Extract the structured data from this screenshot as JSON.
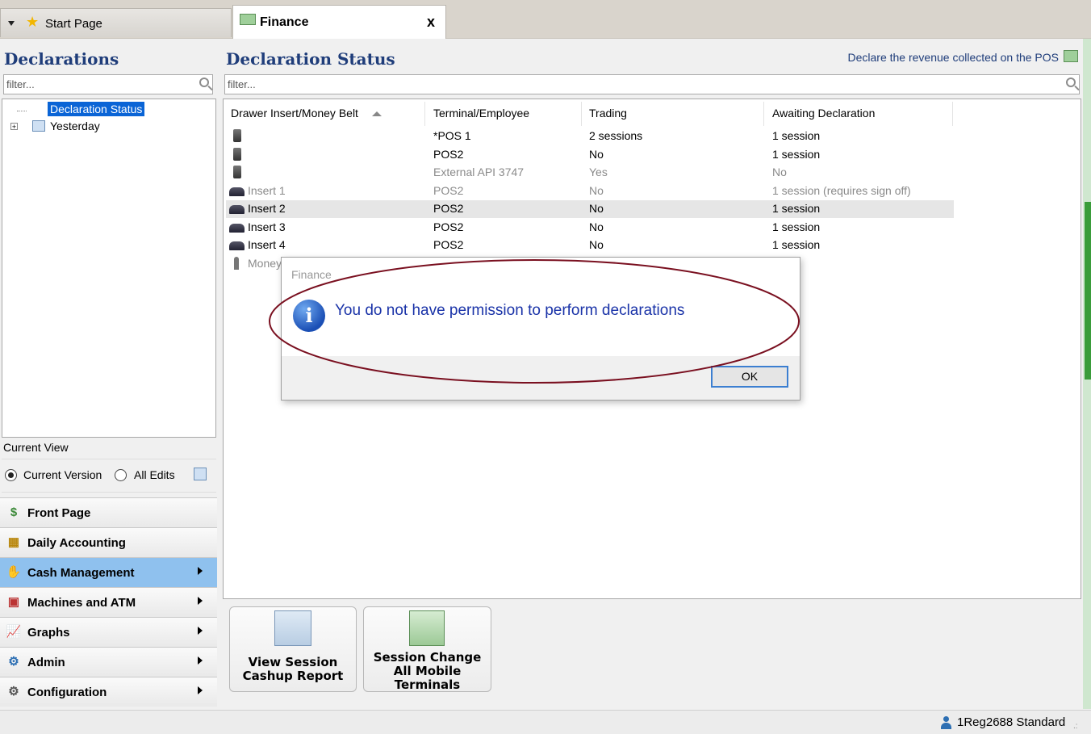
{
  "tabs": {
    "start_label": "Start Page",
    "finance_label": "Finance",
    "close_glyph": "x"
  },
  "sidebar": {
    "title": "Declarations",
    "filter_placeholder": "filter...",
    "tree": [
      {
        "label": "Declaration Status",
        "selected": true
      },
      {
        "label": "Yesterday",
        "selected": false
      }
    ],
    "current_view_label": "Current View",
    "radio_current": "Current Version",
    "radio_all": "All Edits",
    "nav": [
      {
        "label": "Front Page",
        "icon": "money-icon",
        "active": false,
        "arrow": false
      },
      {
        "label": "Daily Accounting",
        "icon": "calculator-icon",
        "active": false,
        "arrow": false
      },
      {
        "label": "Cash Management",
        "icon": "cash-hand-icon",
        "active": true,
        "arrow": true
      },
      {
        "label": "Machines and ATM",
        "icon": "machine-icon",
        "active": false,
        "arrow": true
      },
      {
        "label": "Graphs",
        "icon": "graph-icon",
        "active": false,
        "arrow": true
      },
      {
        "label": "Admin",
        "icon": "admin-icon",
        "active": false,
        "arrow": true
      },
      {
        "label": "Configuration",
        "icon": "gear-icon",
        "active": false,
        "arrow": true
      }
    ]
  },
  "main": {
    "title": "Declaration Status",
    "hint": "Declare the revenue collected on the POS",
    "filter_placeholder": "filter...",
    "columns": [
      "Drawer Insert/Money Belt",
      "Terminal/Employee",
      "Trading",
      "Awaiting Declaration"
    ],
    "rows": [
      {
        "drawer": "",
        "icon": "terminal",
        "terminal": "*POS 1",
        "trading": "2 sessions",
        "awaiting": "1 session",
        "grey": false,
        "highlight": false
      },
      {
        "drawer": "",
        "icon": "terminal",
        "terminal": "POS2",
        "trading": "No",
        "awaiting": "1 session",
        "grey": false,
        "highlight": false
      },
      {
        "drawer": "",
        "icon": "terminal",
        "terminal": "External API 3747",
        "trading": "Yes",
        "awaiting": "No",
        "grey": true,
        "highlight": false
      },
      {
        "drawer": "Insert 1",
        "icon": "insert",
        "terminal": "POS2",
        "trading": "No",
        "awaiting": "1 session (requires sign off)",
        "grey": true,
        "highlight": false
      },
      {
        "drawer": "Insert 2",
        "icon": "insert",
        "terminal": "POS2",
        "trading": "No",
        "awaiting": "1 session",
        "grey": false,
        "highlight": true
      },
      {
        "drawer": "Insert 3",
        "icon": "insert",
        "terminal": "POS2",
        "trading": "No",
        "awaiting": "1 session",
        "grey": false,
        "highlight": false
      },
      {
        "drawer": "Insert 4",
        "icon": "insert",
        "terminal": "POS2",
        "trading": "No",
        "awaiting": "1 session",
        "grey": false,
        "highlight": false
      },
      {
        "drawer": "Money",
        "icon": "person",
        "terminal": "",
        "trading": "",
        "awaiting": "",
        "grey": true,
        "highlight": false
      }
    ],
    "actions": [
      {
        "label_lines": [
          "View Session",
          "Cashup Report"
        ],
        "icon": "report-icon"
      },
      {
        "label_lines": [
          "Session Change",
          "All Mobile",
          "Terminals"
        ],
        "icon": "session-change-icon"
      }
    ]
  },
  "dialog": {
    "title": "Finance",
    "message": "You do not have permission to perform declarations",
    "ok": "OK"
  },
  "status": {
    "user": "1Reg2688 Standard"
  },
  "colors": {
    "header_blue": "#1f3d7a",
    "active_nav": "#8fc1ee",
    "selected_tree": "#0a64d6",
    "annotation_ellipse": "#7a1020",
    "dialog_text": "#1a33a8"
  }
}
